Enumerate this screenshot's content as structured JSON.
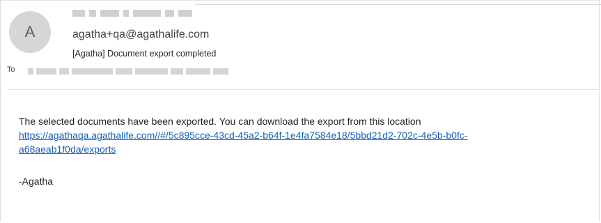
{
  "message": {
    "avatar_initial": "A",
    "from_address": "agatha+qa@agathalife.com",
    "subject": "[Agatha] Document export completed",
    "to_label": "To"
  },
  "body": {
    "text": "The selected documents have been exported. You can download the export from this location",
    "link_line1": "https://agathaqa.agathalife.com//#/5c895cce-43cd-45a2-b64f-1e4fa7584e18/5bbd21d2-702c-4e5b-b0fc-",
    "link_line2": "a68aeab1f0da/exports",
    "sign_off": "-Agatha"
  }
}
